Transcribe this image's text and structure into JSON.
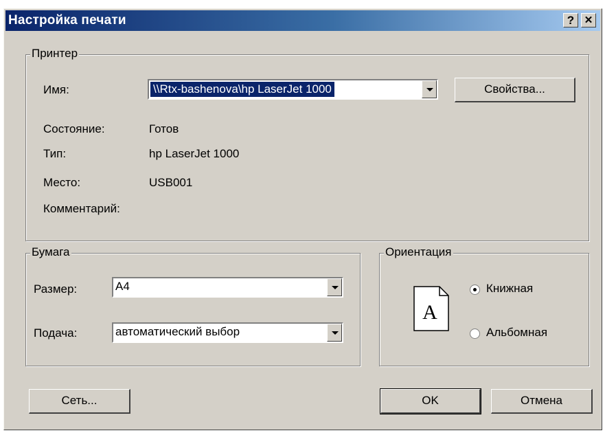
{
  "window": {
    "title": "Настройка печати",
    "help_btn": "?",
    "close_btn": "✕"
  },
  "printer": {
    "group_label": "Принтер",
    "name_label": "Имя:",
    "name_value": "\\\\Rtx-bashenova\\hp LaserJet 1000",
    "properties_btn": "Свойства...",
    "status_label": "Состояние:",
    "status_value": "Готов",
    "type_label": "Тип:",
    "type_value": "hp LaserJet 1000",
    "location_label": "Место:",
    "location_value": "USB001",
    "comment_label": "Комментарий:",
    "comment_value": ""
  },
  "paper": {
    "group_label": "Бумага",
    "size_label": "Размер:",
    "size_value": "A4",
    "source_label": "Подача:",
    "source_value": "автоматический выбор"
  },
  "orientation": {
    "group_label": "Ориентация",
    "icon_letter": "A",
    "portrait_label": "Книжная",
    "landscape_label": "Альбомная",
    "selected": "portrait"
  },
  "footer": {
    "network_btn": "Сеть...",
    "ok_btn": "OK",
    "cancel_btn": "Отмена"
  }
}
